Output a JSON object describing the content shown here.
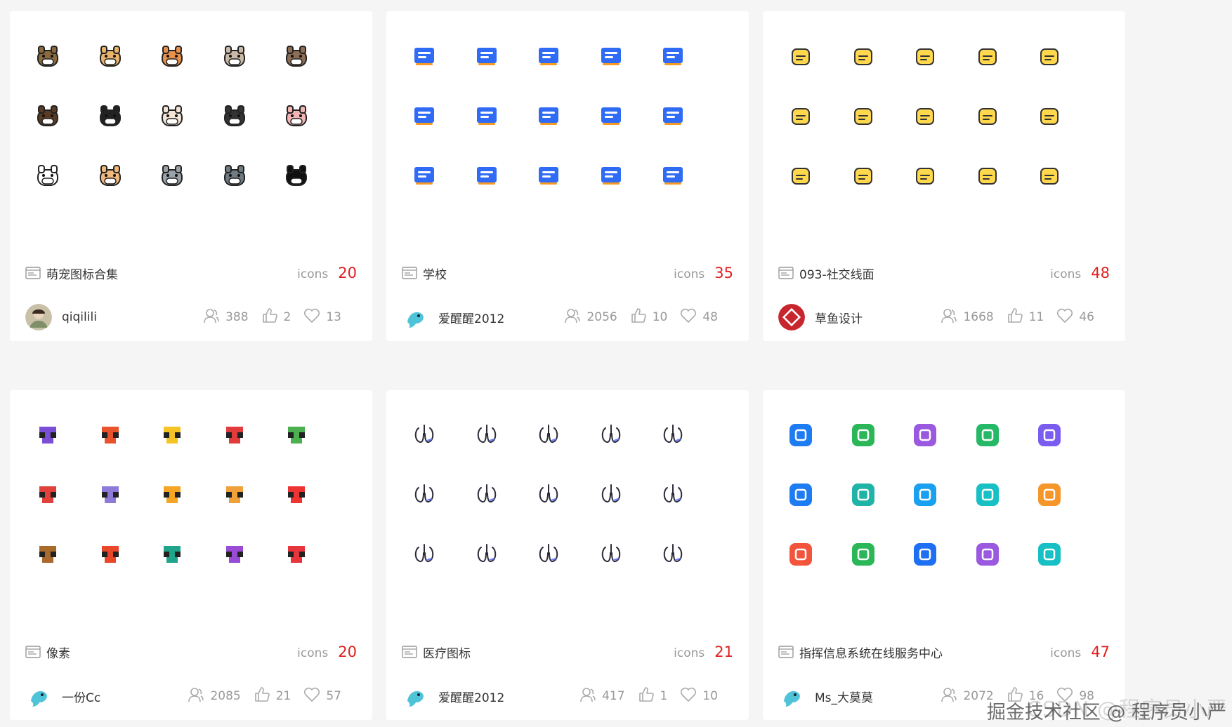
{
  "cards": [
    {
      "title": "萌宠图标合集",
      "count_label": "icons",
      "count": "20",
      "author": "qiqilili",
      "views": "388",
      "likes": "2",
      "favorites": "13",
      "avatar": "photo-avatar",
      "icons": [
        "turtle-sign-icon",
        "hamster-icon",
        "shiba-dog-icon",
        "cat-face-icon",
        "puppy-sign-icon",
        "dachshund-icon",
        "husky-black-icon",
        "white-dog-icon",
        "husky-icon",
        "pig-icon",
        "duck-icon",
        "orange-cat-icon",
        "gray-cat-sign-icon",
        "gray-cat-icon",
        "tuxedo-cat-icon"
      ]
    },
    {
      "title": "学校",
      "count_label": "icons",
      "count": "35",
      "author": "爱醒醒2012",
      "views": "2056",
      "likes": "10",
      "favorites": "48",
      "avatar": "fish-avatar",
      "icons": [
        "bed-icon",
        "id-board-icon",
        "wrench-icon",
        "star-board-icon",
        "thumbs-up-icon",
        "clover-icon",
        "calendar-check-icon",
        "lectern-icon",
        "clipboard-user-icon",
        "award-badge-icon",
        "clipboard-swap-icon",
        "calendar-grid-icon",
        "user-icon",
        "board-check-icon",
        "crown-icon"
      ]
    },
    {
      "title": "093-社交线面",
      "count_label": "icons",
      "count": "48",
      "author": "草鱼设计",
      "views": "1668",
      "likes": "11",
      "favorites": "46",
      "avatar": "brand-avatar",
      "icons": [
        "shield-check-icon",
        "floppy-disk-icon",
        "smile-icon",
        "film-reel-icon",
        "bookmark-plus-icon",
        "lightbulb-icon",
        "monitor-icon",
        "like-icon",
        "gift-box-icon",
        "ticket-icon",
        "shopping-cart-icon",
        "shopping-bag-icon",
        "timer-icon",
        "user-circle-icon",
        "battery-icon"
      ]
    },
    {
      "title": "像素",
      "count_label": "icons",
      "count": "20",
      "author": "一份Cc",
      "views": "2085",
      "likes": "21",
      "favorites": "57",
      "avatar": "fish-avatar",
      "icons": [
        "bomb-icon",
        "fire-icon",
        "sun-flower-icon",
        "red-mushroom-icon",
        "green-mushroom-icon",
        "piranha-plant-icon",
        "purple-flower-icon",
        "butterfly-orange-icon",
        "pizza-icon",
        "mario-icon",
        "burger-icon",
        "parrot-icon",
        "butterfly-teal-icon",
        "butterfly-purple-icon",
        "heart-bubble-icon"
      ]
    },
    {
      "title": "医疗图标",
      "count_label": "icons",
      "count": "21",
      "author": "爱醒醒2012",
      "views": "417",
      "likes": "1",
      "favorites": "10",
      "avatar": "fish-avatar",
      "icons": [
        "lungs-icon",
        "pill-icon",
        "intestine-icon",
        "iv-drip-icon",
        "nose-icon",
        "microscope-slide-icon",
        "uterus-icon",
        "bandage-icon",
        "virus-icon",
        "person-care-icon",
        "lungs-outline-icon",
        "cell-icon",
        "stomach-icon",
        "scissors-icon",
        "kidneys-icon"
      ]
    },
    {
      "title": "指挥信息系统在线服务中心",
      "count_label": "icons",
      "count": "47",
      "author": "Ms_大莫莫",
      "views": "2072",
      "likes": "16",
      "favorites": "98",
      "avatar": "fish-avatar",
      "icons": [
        "speaker-icon",
        "cone-icon",
        "chat-icon",
        "cloud-check-icon",
        "send-icon",
        "location-icon",
        "document-icon",
        "key-icon",
        "tools-icon",
        "star-folder-icon",
        "book-icon",
        "exchange-icon",
        "upload-icon",
        "notes-icon",
        "cloud-upload-icon"
      ]
    }
  ],
  "watermark": "掘金技术社区 @ 程序员小严",
  "watermark_bg": "CSDN @程序员小严",
  "colors": {
    "accent_red": "#e02020",
    "blue": "#2f7cf6",
    "school_blue": "#2f6bf5",
    "muted": "#999999",
    "title_text": "#333333"
  }
}
